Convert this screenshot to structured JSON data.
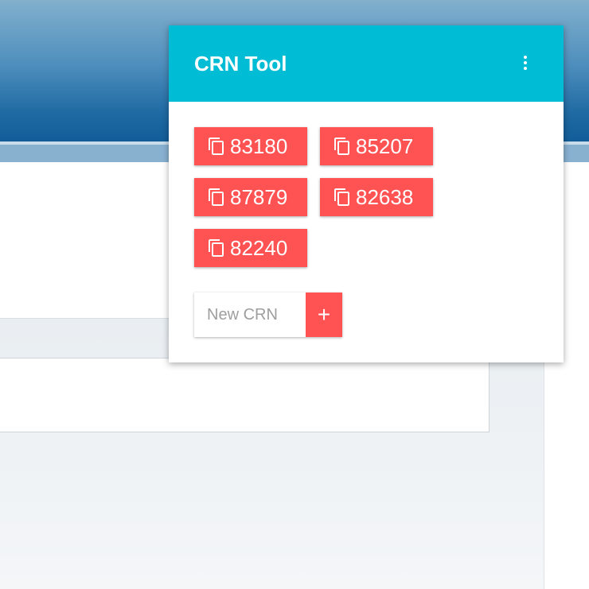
{
  "popup": {
    "title": "CRN Tool",
    "menu_icon": "more-vert-icon"
  },
  "crns": [
    "83180",
    "85207",
    "87879",
    "82638",
    "82240"
  ],
  "chip_icon": "copy-icon",
  "new_crn": {
    "placeholder": "New CRN",
    "value": "",
    "add_label": "+"
  },
  "colors": {
    "header": "#00bcd4",
    "chip": "#ff5252",
    "page_header": "#1f6aa3"
  }
}
